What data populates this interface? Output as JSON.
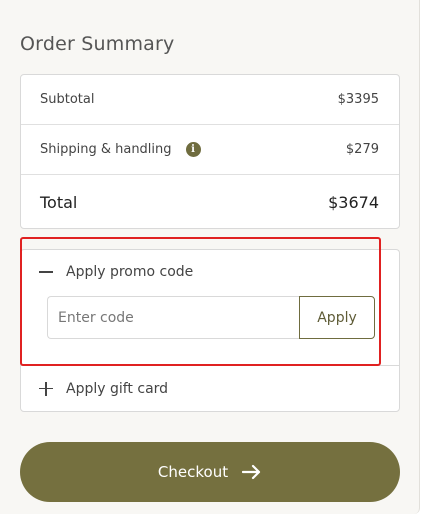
{
  "order_summary": {
    "title": "Order Summary",
    "subtotal": {
      "label": "Subtotal",
      "value": "$3395"
    },
    "shipping": {
      "label": "Shipping & handling",
      "value": "$279",
      "info_icon": "info-icon"
    },
    "total": {
      "label": "Total",
      "value": "$3674"
    }
  },
  "promo": {
    "toggle_label": "Apply promo code",
    "toggle_icon": "minus-icon",
    "placeholder": "Enter code",
    "apply_label": "Apply"
  },
  "gift_card": {
    "label": "Apply gift card",
    "icon": "plus-icon"
  },
  "checkout": {
    "label": "Checkout",
    "icon": "arrow-right-icon"
  },
  "colors": {
    "accent": "#75703f",
    "highlight": "#e02121"
  }
}
